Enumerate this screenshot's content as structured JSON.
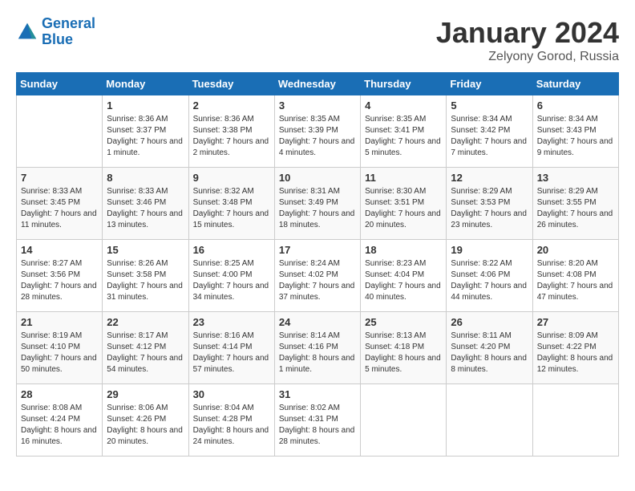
{
  "header": {
    "logo_line1": "General",
    "logo_line2": "Blue",
    "month_year": "January 2024",
    "location": "Zelyony Gorod, Russia"
  },
  "weekdays": [
    "Sunday",
    "Monday",
    "Tuesday",
    "Wednesday",
    "Thursday",
    "Friday",
    "Saturday"
  ],
  "weeks": [
    [
      {
        "day": "",
        "sunrise": "",
        "sunset": "",
        "daylight": ""
      },
      {
        "day": "1",
        "sunrise": "Sunrise: 8:36 AM",
        "sunset": "Sunset: 3:37 PM",
        "daylight": "Daylight: 7 hours and 1 minute."
      },
      {
        "day": "2",
        "sunrise": "Sunrise: 8:36 AM",
        "sunset": "Sunset: 3:38 PM",
        "daylight": "Daylight: 7 hours and 2 minutes."
      },
      {
        "day": "3",
        "sunrise": "Sunrise: 8:35 AM",
        "sunset": "Sunset: 3:39 PM",
        "daylight": "Daylight: 7 hours and 4 minutes."
      },
      {
        "day": "4",
        "sunrise": "Sunrise: 8:35 AM",
        "sunset": "Sunset: 3:41 PM",
        "daylight": "Daylight: 7 hours and 5 minutes."
      },
      {
        "day": "5",
        "sunrise": "Sunrise: 8:34 AM",
        "sunset": "Sunset: 3:42 PM",
        "daylight": "Daylight: 7 hours and 7 minutes."
      },
      {
        "day": "6",
        "sunrise": "Sunrise: 8:34 AM",
        "sunset": "Sunset: 3:43 PM",
        "daylight": "Daylight: 7 hours and 9 minutes."
      }
    ],
    [
      {
        "day": "7",
        "sunrise": "Sunrise: 8:33 AM",
        "sunset": "Sunset: 3:45 PM",
        "daylight": "Daylight: 7 hours and 11 minutes."
      },
      {
        "day": "8",
        "sunrise": "Sunrise: 8:33 AM",
        "sunset": "Sunset: 3:46 PM",
        "daylight": "Daylight: 7 hours and 13 minutes."
      },
      {
        "day": "9",
        "sunrise": "Sunrise: 8:32 AM",
        "sunset": "Sunset: 3:48 PM",
        "daylight": "Daylight: 7 hours and 15 minutes."
      },
      {
        "day": "10",
        "sunrise": "Sunrise: 8:31 AM",
        "sunset": "Sunset: 3:49 PM",
        "daylight": "Daylight: 7 hours and 18 minutes."
      },
      {
        "day": "11",
        "sunrise": "Sunrise: 8:30 AM",
        "sunset": "Sunset: 3:51 PM",
        "daylight": "Daylight: 7 hours and 20 minutes."
      },
      {
        "day": "12",
        "sunrise": "Sunrise: 8:29 AM",
        "sunset": "Sunset: 3:53 PM",
        "daylight": "Daylight: 7 hours and 23 minutes."
      },
      {
        "day": "13",
        "sunrise": "Sunrise: 8:29 AM",
        "sunset": "Sunset: 3:55 PM",
        "daylight": "Daylight: 7 hours and 26 minutes."
      }
    ],
    [
      {
        "day": "14",
        "sunrise": "Sunrise: 8:27 AM",
        "sunset": "Sunset: 3:56 PM",
        "daylight": "Daylight: 7 hours and 28 minutes."
      },
      {
        "day": "15",
        "sunrise": "Sunrise: 8:26 AM",
        "sunset": "Sunset: 3:58 PM",
        "daylight": "Daylight: 7 hours and 31 minutes."
      },
      {
        "day": "16",
        "sunrise": "Sunrise: 8:25 AM",
        "sunset": "Sunset: 4:00 PM",
        "daylight": "Daylight: 7 hours and 34 minutes."
      },
      {
        "day": "17",
        "sunrise": "Sunrise: 8:24 AM",
        "sunset": "Sunset: 4:02 PM",
        "daylight": "Daylight: 7 hours and 37 minutes."
      },
      {
        "day": "18",
        "sunrise": "Sunrise: 8:23 AM",
        "sunset": "Sunset: 4:04 PM",
        "daylight": "Daylight: 7 hours and 40 minutes."
      },
      {
        "day": "19",
        "sunrise": "Sunrise: 8:22 AM",
        "sunset": "Sunset: 4:06 PM",
        "daylight": "Daylight: 7 hours and 44 minutes."
      },
      {
        "day": "20",
        "sunrise": "Sunrise: 8:20 AM",
        "sunset": "Sunset: 4:08 PM",
        "daylight": "Daylight: 7 hours and 47 minutes."
      }
    ],
    [
      {
        "day": "21",
        "sunrise": "Sunrise: 8:19 AM",
        "sunset": "Sunset: 4:10 PM",
        "daylight": "Daylight: 7 hours and 50 minutes."
      },
      {
        "day": "22",
        "sunrise": "Sunrise: 8:17 AM",
        "sunset": "Sunset: 4:12 PM",
        "daylight": "Daylight: 7 hours and 54 minutes."
      },
      {
        "day": "23",
        "sunrise": "Sunrise: 8:16 AM",
        "sunset": "Sunset: 4:14 PM",
        "daylight": "Daylight: 7 hours and 57 minutes."
      },
      {
        "day": "24",
        "sunrise": "Sunrise: 8:14 AM",
        "sunset": "Sunset: 4:16 PM",
        "daylight": "Daylight: 8 hours and 1 minute."
      },
      {
        "day": "25",
        "sunrise": "Sunrise: 8:13 AM",
        "sunset": "Sunset: 4:18 PM",
        "daylight": "Daylight: 8 hours and 5 minutes."
      },
      {
        "day": "26",
        "sunrise": "Sunrise: 8:11 AM",
        "sunset": "Sunset: 4:20 PM",
        "daylight": "Daylight: 8 hours and 8 minutes."
      },
      {
        "day": "27",
        "sunrise": "Sunrise: 8:09 AM",
        "sunset": "Sunset: 4:22 PM",
        "daylight": "Daylight: 8 hours and 12 minutes."
      }
    ],
    [
      {
        "day": "28",
        "sunrise": "Sunrise: 8:08 AM",
        "sunset": "Sunset: 4:24 PM",
        "daylight": "Daylight: 8 hours and 16 minutes."
      },
      {
        "day": "29",
        "sunrise": "Sunrise: 8:06 AM",
        "sunset": "Sunset: 4:26 PM",
        "daylight": "Daylight: 8 hours and 20 minutes."
      },
      {
        "day": "30",
        "sunrise": "Sunrise: 8:04 AM",
        "sunset": "Sunset: 4:28 PM",
        "daylight": "Daylight: 8 hours and 24 minutes."
      },
      {
        "day": "31",
        "sunrise": "Sunrise: 8:02 AM",
        "sunset": "Sunset: 4:31 PM",
        "daylight": "Daylight: 8 hours and 28 minutes."
      },
      {
        "day": "",
        "sunrise": "",
        "sunset": "",
        "daylight": ""
      },
      {
        "day": "",
        "sunrise": "",
        "sunset": "",
        "daylight": ""
      },
      {
        "day": "",
        "sunrise": "",
        "sunset": "",
        "daylight": ""
      }
    ]
  ]
}
